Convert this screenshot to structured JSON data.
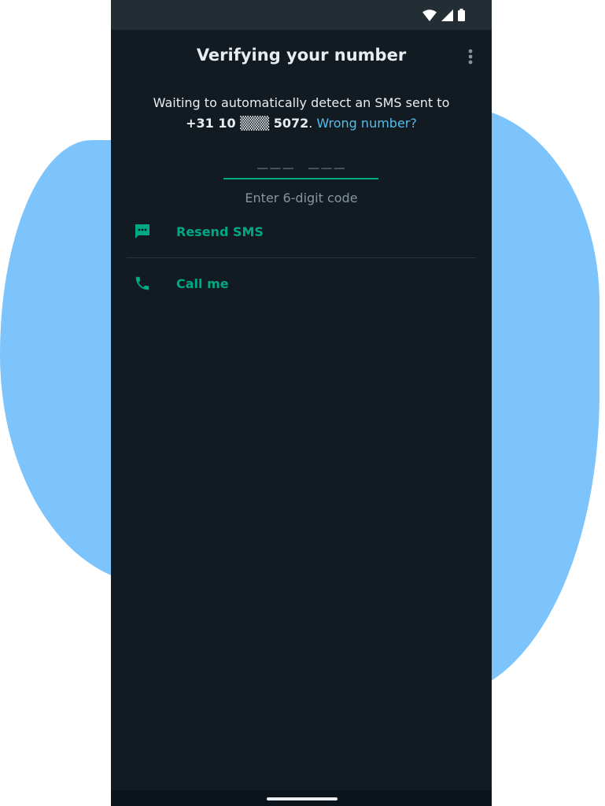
{
  "app": {
    "title": "Verifying your number"
  },
  "verification": {
    "description_prefix": "Waiting to automatically detect an SMS sent to",
    "phone_number": "+31 10 ▒▒▒ 5072",
    "punctuation": ".",
    "wrong_number_link": "Wrong number?",
    "code_placeholder": "___ ___",
    "code_hint": "Enter 6-digit code"
  },
  "actions": {
    "resend_sms": "Resend SMS",
    "call_me": "Call me"
  },
  "colors": {
    "background": "#121b22",
    "accent": "#00a884",
    "link": "#53bdeb",
    "blob": "#7cc4fb"
  },
  "icons": {
    "status": [
      "wifi-icon",
      "cell-signal-icon",
      "battery-icon"
    ],
    "menu": "more-vert-icon",
    "resend": "message-icon",
    "call": "phone-icon"
  }
}
